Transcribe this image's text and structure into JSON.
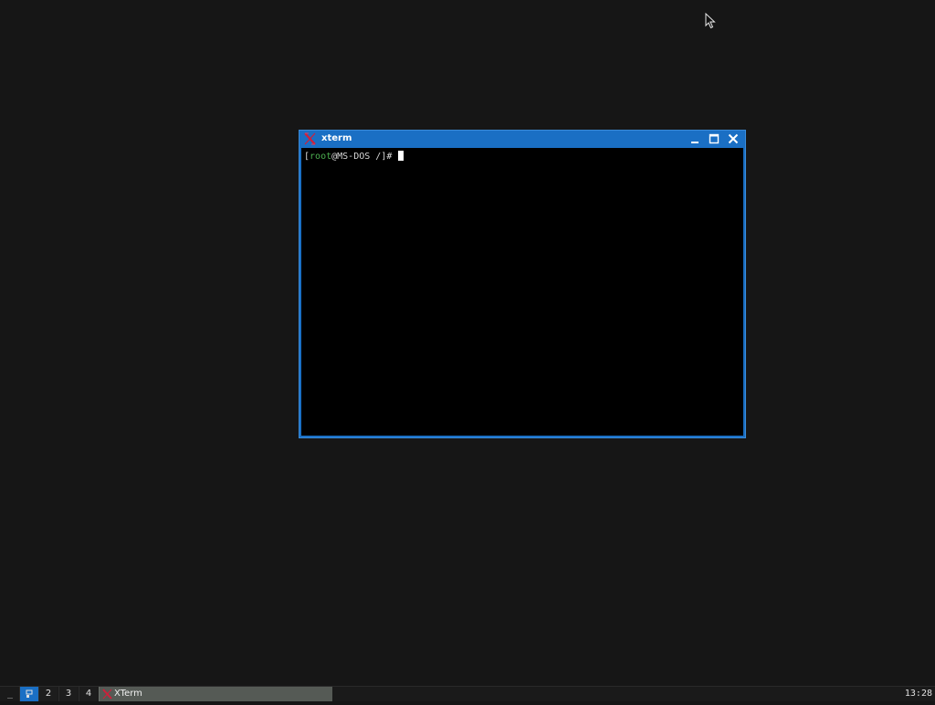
{
  "window": {
    "title": "xterm",
    "icon": "x-logo-icon"
  },
  "terminal": {
    "prompt_open": "[",
    "user": "root",
    "at_host": "@MS-DOS",
    "path": " /",
    "prompt_close": "]#",
    "input": " "
  },
  "taskbar": {
    "show_desktop_label": "_",
    "workspaces": [
      "1",
      "2",
      "3",
      "4"
    ],
    "active_workspace": "1",
    "tasks": [
      {
        "label": "XTerm",
        "icon": "x-logo-icon"
      }
    ],
    "clock": "13:28"
  },
  "colors": {
    "desktop_bg": "#161616",
    "window_frame": "#1a6fc4",
    "terminal_bg": "#000000",
    "prompt_user": "#4caf50",
    "task_active_bg": "#555a55"
  }
}
